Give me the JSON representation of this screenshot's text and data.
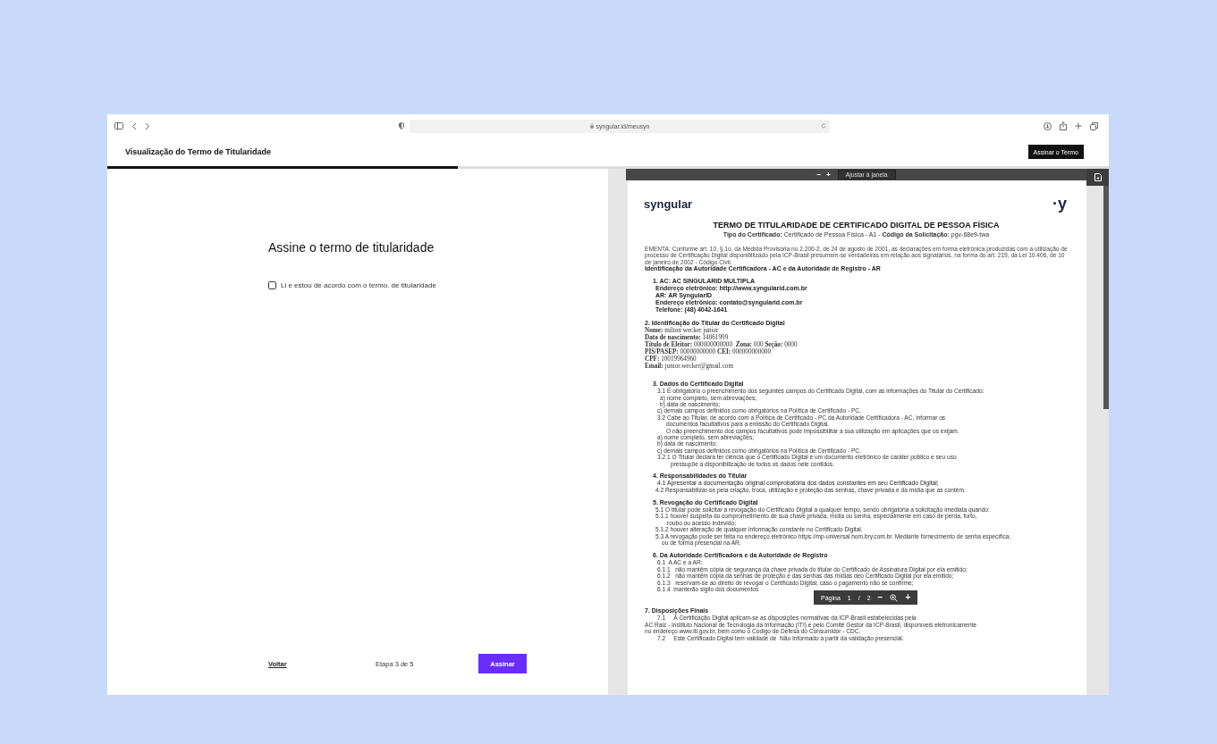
{
  "browser": {
    "url": "syngular.id/meusyn"
  },
  "header": {
    "title": "Visualização do Termo de Titularidade",
    "button": "Assinar o Termo"
  },
  "progress": {
    "level": 0.35
  },
  "form": {
    "heading": "Assine o termo de titularidade",
    "agree": {
      "label": "Li e estou de acordo com o termo. de titularidade",
      "checked": false
    }
  },
  "footer": {
    "back": "Voltar",
    "step": "Etapa 3 de 5",
    "submit": "Assinar"
  },
  "pdf_viewer": {
    "toolbar": {
      "zoom_out": "−",
      "zoom_in": "+",
      "fit": "Ajustar à janela"
    },
    "document": {
      "logo": "syngular",
      "logo_mark": "·y",
      "title": "TERMO DE TITULARIDADE DE CERTIFICADO DIGITAL DE PESSOA FÍSICA",
      "subtitle": "**Tipo do Certificado:** Certificado de Pessoa Física - A1 - **Código da Solicitação:** pgv-68e9-twa",
      "ementa": "EMENTA: Conforme art. 10, § 1o, da Medida Provisória no 2.200-2, de 24 de agosto de 2001, as declarações em forma eletrônica produzidas com a utilização de processo de Certificação Digital disponibilizado pela ICP-Brasil presumem-se verdadeiras em relação aos signatários, na forma do art. 219, da Lei 10.406, de 10 de janeiro de 2002 - Código Civil.",
      "identification": "Identificação da Autoridade Certificadora - AC e da  Autoridade de Registro - AR",
      "sections": [
        {
          "lines": [
            {
              "kind": "subheading",
              "text": "1. AC: AC SINGULARID MULTIPLA"
            },
            {
              "kind": "detail",
              "text": "Endereço eletrônico: http://www.syngularid.com.br"
            },
            {
              "kind": "detail",
              "text": "AR: AR SyngularID"
            },
            {
              "kind": "detail",
              "text": "Endereço eletrônico: contato@syngularid.com.br"
            },
            {
              "kind": "detail",
              "text": "Telefone: (48) 4042-1641"
            }
          ]
        },
        {
          "lines": [
            {
              "kind": "heading",
              "text": "2. Identificação do Titular do Certificado Digital"
            },
            {
              "kind": "field",
              "text": "**Nome:** milton wecker junior"
            },
            {
              "kind": "field",
              "text": "**Data de nascimento:** 14061999"
            },
            {
              "kind": "field",
              "text": "**Título de Eleitor:** 000000000000  **Zona:** 000 **Seção:** 0000"
            },
            {
              "kind": "field",
              "text": "**PIS/PASEP:** 00000000000 **CEI:** 000000000000"
            },
            {
              "kind": "field",
              "text": "**CPF:** 10019964960"
            },
            {
              "kind": "field",
              "text": "**Email:** junior.wecker@gmail.com"
            }
          ]
        },
        {
          "lines": [
            {
              "kind": "subheading",
              "text": "3. Dados do Certificado Digital"
            },
            {
              "kind": "clause",
              "text": "3.1 É obrigatório o preenchimento dos seguintes campos do Certificado Digital, com as informações do Titular do Certificado:"
            },
            {
              "kind": "option",
              "text": "a) nome completo, sem abreviações;"
            },
            {
              "kind": "option",
              "text": "b) data de nascimento;"
            },
            {
              "kind": "clause",
              "text": "c) demais campos definidos como obrigatórios na Política de Certificado - PC."
            },
            {
              "kind": "clause",
              "text": "3.2 Cabe ao Titular, de acordo com a Política de Certificado - PC da Autoridade Certificadora - AC, informar os"
            },
            {
              "kind": "indented",
              "text": "documentos facultativos para a emissão do Certificado Digital."
            },
            {
              "kind": "indented",
              "text": "O não preenchimento dos campos facultativos pode impossibilitar a sua utilização em aplicações que os exijam."
            },
            {
              "kind": "clause",
              "text": "a) nome completo, sem abreviações;"
            },
            {
              "kind": "clause",
              "text": "b) data de nascimento;"
            },
            {
              "kind": "clause",
              "text": "c) demais campos definidos como obrigatórios na Política de Certificado - PC."
            },
            {
              "kind": "clause",
              "text": "3.2.1 O Titular declara ter ciência que o Certificado Digital é um documento eletrônico de caráter público e seu uso"
            },
            {
              "kind": "wrapped",
              "text": "pressupõe a disponibilização de todos os dados nele contidos."
            }
          ]
        },
        {
          "lines": [
            {
              "kind": "subheading",
              "text": "4. Responsabilidades do Titular"
            },
            {
              "kind": "emphasis",
              "text": "4.1 Apresentar a documentação original comprobatória dos dados constantes em seu Certificado Digital;"
            },
            {
              "kind": "note",
              "text": "4.2 Responsabilizar-se pela criação, troca, utilização e proteção das senhas, chave privada e da mídia que as contém."
            }
          ]
        },
        {
          "lines": [
            {
              "kind": "minorheading",
              "text": "5. Revogação do Certificado Digital"
            },
            {
              "kind": "note",
              "text": "5.1 O titular pode solicitar a revogação do Certificado Digital a qualquer tempo, sendo obrigatória a solicitação imediata quando:"
            },
            {
              "kind": "note",
              "text": "5.1.1 houver suspeita do comprometimento de sua chave privada, mídia ou senha, especialmente em caso de perda, furto,"
            },
            {
              "kind": "notewrap",
              "text": "roubo ou acesso indevido;"
            },
            {
              "kind": "note",
              "text": "5.1.2 houver alteração de qualquer informação constante no Certificado Digital."
            },
            {
              "kind": "note",
              "text": "5.3 A revogação pode ser feita no endereço eletrônico https://mp-universal.hom.bry.com.br. Mediante fornecimento de senha específica,"
            },
            {
              "kind": "noteindent",
              "text": "ou de forma presencial na AR."
            }
          ]
        },
        {
          "lines": [
            {
              "kind": "subheading",
              "text": "6. Da Autoridade Certificadora e da Autoridade de Registro"
            },
            {
              "kind": "clause",
              "text": "6.1  A AC e a AR:"
            },
            {
              "kind": "clause",
              "text": "6.1.1   não mantêm cópia de segurança da chave privada do titular do Certificado de Assinatura Digital por ela emitido;"
            },
            {
              "kind": "clause",
              "text": "6.1.2   não mantêm cópia da senhas de proteção e das senhas das mídias deo Certificado Digital por ela emitido;"
            },
            {
              "kind": "clause",
              "text": "6.1.3   reservam-se ao direito de revogar o Certificado Digital, caso o pagamento não se confirme;"
            },
            {
              "kind": "clause",
              "text": "6.1.4  manterão sigilo dos documentos"
            }
          ]
        },
        {
          "lines": [
            {
              "kind": "heading",
              "text": "7. Disposições Finais"
            },
            {
              "kind": "clause",
              "text": "7.1     À Certificação Digital aplicam-se as disposições normativas da ICP-Brasil estabelecidas pela"
            },
            {
              "kind": "flush",
              "text": "AC Raiz - Instituto Nacional de Tecnologia da Informação (ITI) e pelo Comitê Gestor da ICP-Brasil, disponíveis eletronicamente"
            },
            {
              "kind": "flush",
              "text": "no endereço www.iti.gov.br, bem como o Código de Defesa do Consumidor - CDC."
            },
            {
              "kind": "clause",
              "text": "7.2     Este Certificado Digital tem validade de  Não Informado a partir da validação presencial."
            }
          ]
        }
      ]
    },
    "pager": {
      "label": "Página",
      "current": "1",
      "separator": "/",
      "total": "2",
      "zoom_out": "−",
      "zoom_in": "+"
    }
  }
}
